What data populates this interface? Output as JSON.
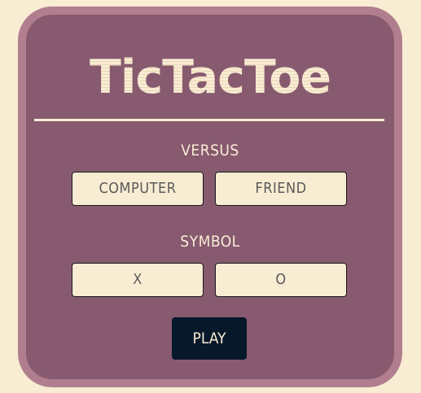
{
  "game": {
    "title": "TicTacToe",
    "versus": {
      "label": "VERSUS",
      "options": [
        "COMPUTER",
        "FRIEND"
      ]
    },
    "symbol": {
      "label": "SYMBOL",
      "options": [
        "X",
        "O"
      ]
    },
    "play_label": "PLAY"
  },
  "colors": {
    "background": "#f8ecd3",
    "card": "#875a70",
    "card_border": "#b07e8e",
    "accent_text": "#f8ecd3",
    "play_button": "#07182a"
  }
}
